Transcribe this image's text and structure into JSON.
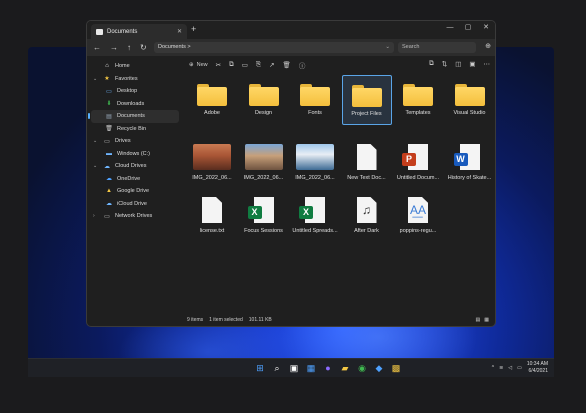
{
  "window": {
    "tab_title": "Documents",
    "tab_close": "✕",
    "new_tab": "+",
    "controls": [
      "—",
      "▢",
      "✕"
    ]
  },
  "nav": {
    "back": "←",
    "forward": "→",
    "up": "↑",
    "refresh": "↻",
    "address": "Documents  >",
    "address_chevron": "⌄",
    "search_placeholder": "Search",
    "extra": "⊕"
  },
  "cmdbar": {
    "new_label": "New",
    "new_icon": "⊕",
    "icons": [
      "✂",
      "⧉",
      "▭",
      "⎘",
      "↗",
      "🗑",
      "ⓘ"
    ],
    "right_icons": [
      "⧉",
      "⇅",
      "◫",
      "▣",
      "⋯"
    ]
  },
  "sidebar": [
    {
      "label": "Home",
      "icon": "⌂",
      "indent": 0,
      "arrow": "",
      "color": "#e8e8e8"
    },
    {
      "label": "Favorites",
      "icon": "★",
      "indent": 0,
      "arrow": "⌄",
      "color": "#f3c744"
    },
    {
      "label": "Desktop",
      "icon": "▭",
      "indent": 1,
      "arrow": "",
      "color": "#6fb6ff"
    },
    {
      "label": "Downloads",
      "icon": "⬇",
      "indent": 1,
      "arrow": "",
      "color": "#3fb950"
    },
    {
      "label": "Documents",
      "icon": "▤",
      "indent": 1,
      "arrow": "",
      "color": "#9ab",
      "selected": true
    },
    {
      "label": "Recycle Bin",
      "icon": "🗑",
      "indent": 1,
      "arrow": "",
      "color": "#ccc"
    },
    {
      "label": "Drives",
      "icon": "▭",
      "indent": 0,
      "arrow": "⌄",
      "color": "#ccc"
    },
    {
      "label": "Windows (C:)",
      "icon": "▬",
      "indent": 1,
      "arrow": "",
      "color": "#6fb6ff"
    },
    {
      "label": "Cloud Drives",
      "icon": "☁",
      "indent": 0,
      "arrow": "⌄",
      "color": "#6fb6ff"
    },
    {
      "label": "OneDrive",
      "icon": "☁",
      "indent": 1,
      "arrow": "",
      "color": "#4ea1ff"
    },
    {
      "label": "Google Drive",
      "icon": "▲",
      "indent": 1,
      "arrow": "",
      "color": "#f3c744"
    },
    {
      "label": "iCloud Drive",
      "icon": "☁",
      "indent": 1,
      "arrow": "",
      "color": "#6fb6ff"
    },
    {
      "label": "Network Drives",
      "icon": "▭",
      "indent": 0,
      "arrow": "›",
      "color": "#ccc"
    }
  ],
  "files": [
    {
      "name": "Adobe",
      "kind": "folder"
    },
    {
      "name": "Design",
      "kind": "folder"
    },
    {
      "name": "Fonts",
      "kind": "folder"
    },
    {
      "name": "Project Files",
      "kind": "folder",
      "selected": true
    },
    {
      "name": "Templates",
      "kind": "folder"
    },
    {
      "name": "Visual Studio",
      "kind": "folder"
    },
    {
      "name": "IMG_2022_06...",
      "kind": "image",
      "grad": "linear-gradient(#c97a52 0%, #a85535 45%, #5a2d1f 100%)"
    },
    {
      "name": "IMG_2022_06...",
      "kind": "image",
      "grad": "linear-gradient(#7aa6d6 0%, #c7a07a 45%, #6e5340 100%)"
    },
    {
      "name": "IMG_2022_06...",
      "kind": "image",
      "grad": "linear-gradient(#9fc6ea 0%, #e8eef5 40%, #3d6b95 100%)"
    },
    {
      "name": "New Text Doc...",
      "kind": "doc",
      "badge": "",
      "badge_color": ""
    },
    {
      "name": "Untitled Docum...",
      "kind": "doc",
      "badge": "P",
      "badge_color": "#c43e1c"
    },
    {
      "name": "History of Skate...",
      "kind": "doc",
      "badge": "W",
      "badge_color": "#185abd"
    },
    {
      "name": "license.txt",
      "kind": "doc",
      "badge": "",
      "badge_color": ""
    },
    {
      "name": "Focus Sessions",
      "kind": "doc",
      "badge": "X",
      "badge_color": "#107c41"
    },
    {
      "name": "Untitled Spreads...",
      "kind": "doc",
      "badge": "X",
      "badge_color": "#107c41"
    },
    {
      "name": "After Dark",
      "kind": "glyph",
      "glyph": "♫"
    },
    {
      "name": "poppins-regu...",
      "kind": "glyph",
      "glyph": "A͟A",
      "glyph_color": "#3a7bd5"
    }
  ],
  "status": {
    "count": "9 items",
    "selected": "1 item selected",
    "size": "101.11 KB",
    "views": [
      "▤",
      "▦"
    ]
  },
  "taskbar": {
    "icons": [
      {
        "glyph": "⊞",
        "color": "#4ea1ff",
        "bg": "transparent"
      },
      {
        "glyph": "⌕",
        "color": "#ffffff",
        "bg": "transparent"
      },
      {
        "glyph": "▣",
        "color": "#ffffff",
        "bg": "transparent"
      },
      {
        "glyph": "▦",
        "color": "#4ea1ff",
        "bg": "transparent"
      },
      {
        "glyph": "●",
        "color": "#8c6bff",
        "bg": "transparent"
      },
      {
        "glyph": "▰",
        "color": "#f3c744",
        "bg": "transparent"
      },
      {
        "glyph": "◉",
        "color": "#3fb950",
        "bg": "transparent"
      },
      {
        "glyph": "◆",
        "color": "#4ea1ff",
        "bg": "transparent"
      },
      {
        "glyph": "▩",
        "color": "#f3c744",
        "bg": "transparent"
      }
    ],
    "tray_arrow": "^",
    "tray_icons": [
      "≋",
      "◁",
      "▭"
    ],
    "time": "10:34 AM",
    "date": "6/4/2021"
  }
}
